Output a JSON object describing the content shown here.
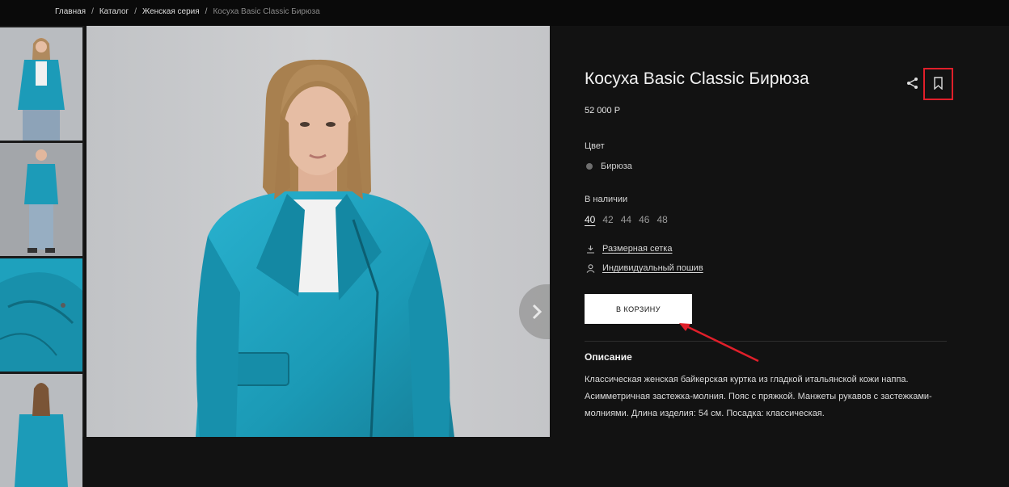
{
  "breadcrumb": {
    "items": [
      "Главная",
      "Каталог",
      "Женская серия"
    ],
    "current": "Косуха Basic Classic Бирюза",
    "separator": "/"
  },
  "product": {
    "title": "Косуха Basic Classic Бирюза",
    "price": "52 000 Р",
    "color_label": "Цвет",
    "color_value": "Бирюза",
    "stock_label": "В наличии",
    "sizes": [
      "40",
      "42",
      "44",
      "46",
      "48"
    ],
    "selected_size": "40",
    "size_chart_link": "Размерная сетка",
    "custom_tailoring_link": "Индивидуальный пошив",
    "cart_button": "В КОРЗИНУ",
    "description_title": "Описание",
    "description_text": "Классическая женская байкерская куртка из гладкой итальянской кожи наппа. Асимметричная застежка-молния. Пояс с пряжкой. Манжеты рукавов с застежками-молниями. Длина изделия: 54 см. Посадка: классическая."
  },
  "icons": {
    "share": "share-icon",
    "bookmark": "bookmark-icon",
    "size_chart": "ruler-icon",
    "tailoring": "person-icon",
    "next": "chevron-right-icon"
  },
  "colors": {
    "jacket": "#1fa3bf",
    "highlight": "#e01f2a",
    "background": "#121212"
  }
}
